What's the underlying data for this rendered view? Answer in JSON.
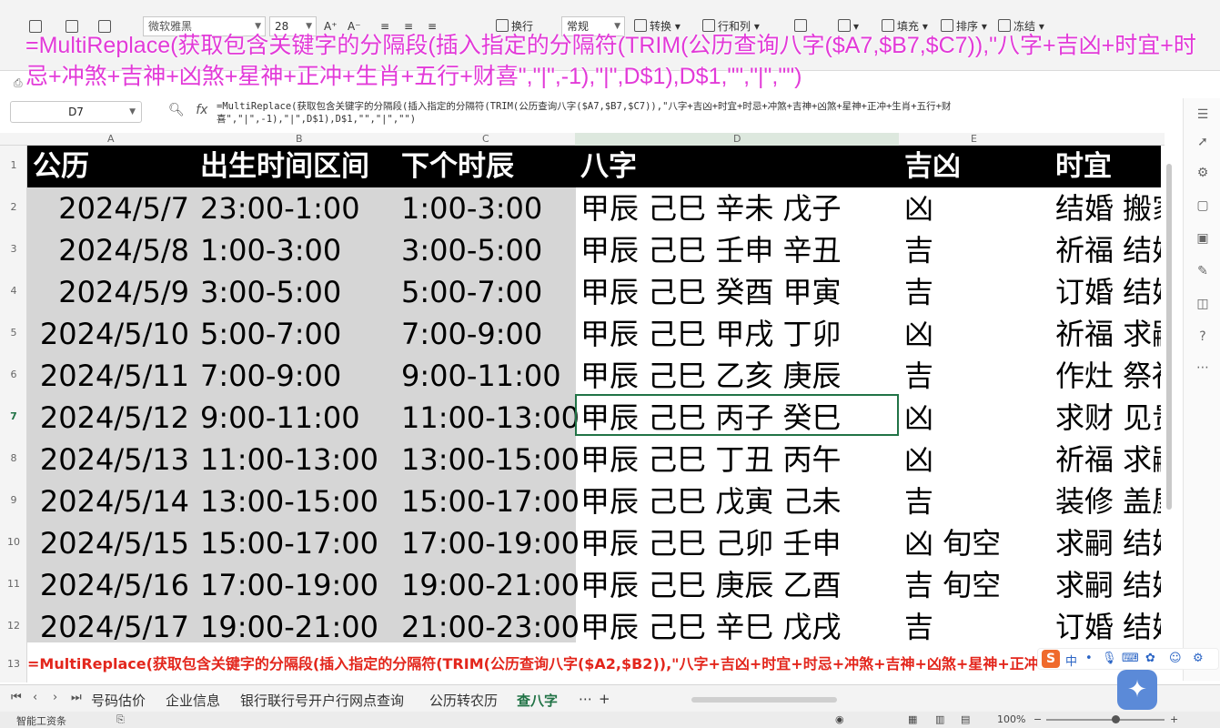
{
  "ribbon": {
    "font_name": "微软雅黑",
    "font_size": "28",
    "number_format": "常规",
    "wrap_label": "换行",
    "convert_label": "转换",
    "rowcol_label": "行和列",
    "fill_label": "填充",
    "sort_label": "排序",
    "freeze_label": "冻结"
  },
  "overlay_caption": "=MultiReplace(获取包含关键字的分隔段(插入指定的分隔符(TRIM(公历查询八字($A7,$B7,$C7)),\"八字+吉凶+时宜+时忌+冲煞+吉神+凶煞+星神+正冲+生肖+五行+财喜\",\"|\",-1),\"|\",D$1),D$1,\"\",\"|\",\"\")",
  "formula_bar": {
    "name_box": "D7",
    "fx": "fx",
    "formula": "=MultiReplace(获取包含关键字的分隔段(插入指定的分隔符(TRIM(公历查询八字($A7,$B7,$C7)),\"八字+吉凶+时宜+时忌+冲煞+吉神+凶煞+星神+正冲+生肖+五行+财喜\",\"|\",-1),\"|\",D$1),D$1,\"\",\"|\",\"\")"
  },
  "columns": [
    "A",
    "B",
    "C",
    "D",
    "E"
  ],
  "row_numbers": [
    "1",
    "2",
    "3",
    "4",
    "5",
    "6",
    "7",
    "8",
    "9",
    "10",
    "11",
    "12",
    "13"
  ],
  "header_row": {
    "a": "公历",
    "b": "出生时间区间",
    "c": "下个时辰",
    "d": "八字",
    "e": "吉凶",
    "f": "时宜"
  },
  "rows": [
    {
      "date": "2024/5/7",
      "range": "23:00-1:00",
      "next": "1:00-3:00",
      "bazi": "甲辰 己巳 辛未 戊子",
      "jx": "凶",
      "yi": "结婚 搬家"
    },
    {
      "date": "2024/5/8",
      "range": "1:00-3:00",
      "next": "3:00-5:00",
      "bazi": "甲辰 己巳 壬申 辛丑",
      "jx": "吉",
      "yi": "祈福 结婚"
    },
    {
      "date": "2024/5/9",
      "range": "3:00-5:00",
      "next": "5:00-7:00",
      "bazi": "甲辰 己巳 癸酉 甲寅",
      "jx": "吉",
      "yi": "订婚 结婚"
    },
    {
      "date": "2024/5/10",
      "range": "5:00-7:00",
      "next": "7:00-9:00",
      "bazi": "甲辰 己巳 甲戌 丁卯",
      "jx": "凶",
      "yi": "祈福 求嗣"
    },
    {
      "date": "2024/5/11",
      "range": "7:00-9:00",
      "next": "9:00-11:00",
      "bazi": "甲辰 己巳 乙亥 庚辰",
      "jx": "吉",
      "yi": "作灶 祭祀"
    },
    {
      "date": "2024/5/12",
      "range": "9:00-11:00",
      "next": "11:00-13:00",
      "bazi": "甲辰 己巳 丙子 癸巳",
      "jx": "凶",
      "yi": "求财 见贵"
    },
    {
      "date": "2024/5/13",
      "range": "11:00-13:00",
      "next": "13:00-15:00",
      "bazi": "甲辰 己巳 丁丑 丙午",
      "jx": "凶",
      "yi": "祈福 求嗣"
    },
    {
      "date": "2024/5/14",
      "range": "13:00-15:00",
      "next": "15:00-17:00",
      "bazi": "甲辰 己巳 戊寅 己未",
      "jx": "吉",
      "yi": "装修 盖屋"
    },
    {
      "date": "2024/5/15",
      "range": "15:00-17:00",
      "next": "17:00-19:00",
      "bazi": "甲辰 己巳 己卯 壬申",
      "jx": "凶 旬空",
      "yi": "求嗣 结婚"
    },
    {
      "date": "2024/5/16",
      "range": "17:00-19:00",
      "next": "19:00-21:00",
      "bazi": "甲辰 己巳 庚辰 乙酉",
      "jx": "吉 旬空",
      "yi": "求嗣 结婚"
    },
    {
      "date": "2024/5/17",
      "range": "19:00-21:00",
      "next": "21:00-23:00",
      "bazi": "甲辰 己巳 辛巳 戊戌",
      "jx": "吉",
      "yi": "订婚 结婚"
    }
  ],
  "row13_text": "=MultiReplace(获取包含关键字的分隔段(插入指定的分隔符(TRIM(公历查询八字($A2,$B2)),\"八字+吉凶+时宜+时忌+冲煞+吉神+凶煞+星神+正冲",
  "sheet_tabs": [
    "号码估价",
    "企业信息",
    "银行联行号开户行网点查询",
    "公历转农历",
    "查八字"
  ],
  "active_tab": "查八字",
  "status": {
    "app": "智能工资条",
    "zoom": "100%"
  },
  "colors": {
    "accent": "#217346",
    "overlay": "#e23ad8",
    "row13": "#e3261c",
    "header_bg": "#000000",
    "gray_fill": "#d6d6d6"
  }
}
